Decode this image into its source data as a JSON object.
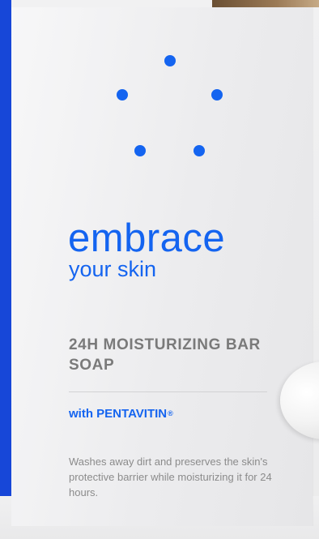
{
  "product": {
    "headline": "embrace",
    "subheadline": "your skin",
    "name": "24H MOISTURIZING BAR SOAP",
    "ingredient_prefix": "with",
    "ingredient_name": "PENTAVITIN",
    "ingredient_mark": "®",
    "description": "Washes away dirt and preserves the skin's protective barrier while moisturizing it for 24 hours."
  },
  "colors": {
    "brand_blue": "#1464f0",
    "side_band_blue": "#1747d8",
    "text_gray": "#7a7a7a"
  },
  "decoration": {
    "dot_count": 5
  }
}
